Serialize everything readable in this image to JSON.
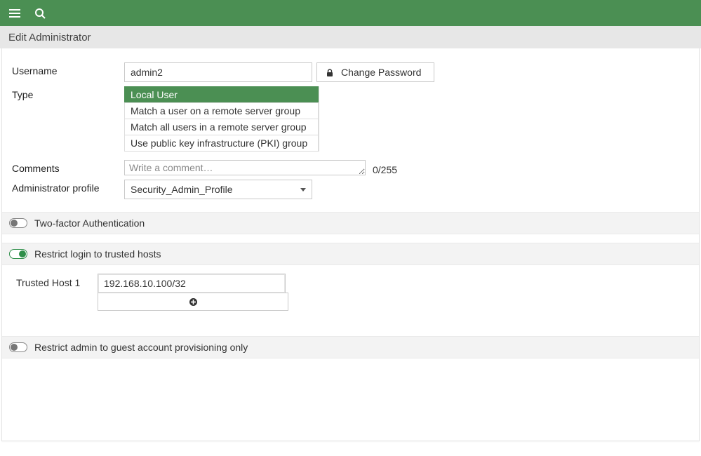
{
  "page_title": "Edit Administrator",
  "username": {
    "label": "Username",
    "value": "admin2"
  },
  "change_password": {
    "label": "Change Password"
  },
  "type": {
    "label": "Type",
    "options": [
      "Local User",
      "Match a user on a remote server group",
      "Match all users in a remote server group",
      "Use public key infrastructure (PKI) group"
    ],
    "selected_index": 0
  },
  "comments": {
    "label": "Comments",
    "value": "",
    "placeholder": "Write a comment…",
    "counter": "0/255"
  },
  "profile": {
    "label": "Administrator profile",
    "value": "Security_Admin_Profile"
  },
  "two_factor": {
    "label": "Two-factor Authentication",
    "enabled": false
  },
  "trusted_hosts": {
    "section_label": "Restrict login to trusted hosts",
    "enabled": true,
    "host_label": "Trusted Host 1",
    "host_value": "192.168.10.100/32"
  },
  "restrict_guest": {
    "label": "Restrict admin to guest account provisioning only",
    "enabled": false
  }
}
